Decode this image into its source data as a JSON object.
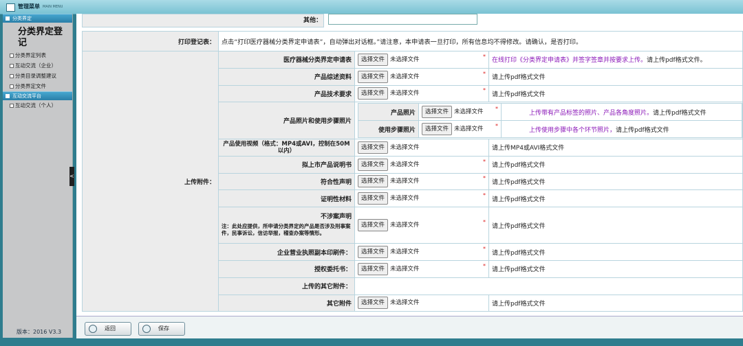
{
  "app": {
    "menu_title": "管理菜单",
    "menu_en": "MAIN MENU",
    "version": "版本：2016 V3.3"
  },
  "sidebar": {
    "section1": "分类界定",
    "big_title": "分类界定登记",
    "items": [
      "分类界定列表",
      "互动交流（企业）",
      "分类目录调整建议",
      "分类界定文件"
    ],
    "section2": "互动交流平台",
    "items2": [
      "互动交流（个人）"
    ]
  },
  "form": {
    "other_label": "其他：",
    "print_label": "打印登记表：",
    "print_text": "点击“打印医疗器械分类界定申请表”，自动弹出对话框。”请注意，本申请表一旦打印，所有信息均不得修改。请确认，是否打印。",
    "upload_label": "上传附件：",
    "choose_file": "选择文件",
    "no_file": "未选择文件",
    "req": "*",
    "rows": [
      {
        "label": "医疗器械分类界定申请表",
        "hint_purple": "在线打印《分类界定申请表》并签字签章并按要求上传。",
        "hint": "请上传pdf格式文件。"
      },
      {
        "label": "产品综述资料",
        "hint": "请上传pdf格式文件"
      },
      {
        "label": "产品技术要求",
        "hint": "请上传pdf格式文件"
      }
    ],
    "photo_group": {
      "label": "产品照片和使用步骤照片",
      "sub": [
        {
          "label": "产品照片",
          "hint_purple": "上传带有产品标签的照片、产品各角度照片。",
          "hint": "请上传pdf格式文件"
        },
        {
          "label": "使用步骤照片",
          "hint_purple": "上传使用步骤中各个环节照片，",
          "hint": "请上传pdf格式文件"
        }
      ]
    },
    "video": {
      "label": "产品使用视频（格式：MP4或AVI，控制在50M以内）",
      "hint": "请上传MP4或AVI格式文件"
    },
    "rows2": [
      {
        "label": "拟上市产品说明书",
        "hint": "请上传pdf格式文件"
      },
      {
        "label": "符合性声明",
        "hint": "请上传pdf格式文件"
      },
      {
        "label": "证明性材料",
        "hint": "请上传pdf格式文件"
      }
    ],
    "noninvolve": {
      "label": "不涉案声明",
      "note": "注：此处应提供，所申请分类界定的产品是否涉及刑事案件，民事诉讼，信访举报，稽查办案等情形。",
      "hint": "请上传pdf格式文件"
    },
    "rows3": [
      {
        "label": "企业营业执照副本印刷件：",
        "hint": "请上传pdf格式文件"
      },
      {
        "label": "授权委托书：",
        "hint": "请上传pdf格式文件"
      }
    ],
    "other_attach_label": "上传的其它附件：",
    "other_row": {
      "label": "其它附件",
      "hint": "请上传pdf格式文件"
    }
  },
  "footer": {
    "back": "返回",
    "save": "保存"
  }
}
